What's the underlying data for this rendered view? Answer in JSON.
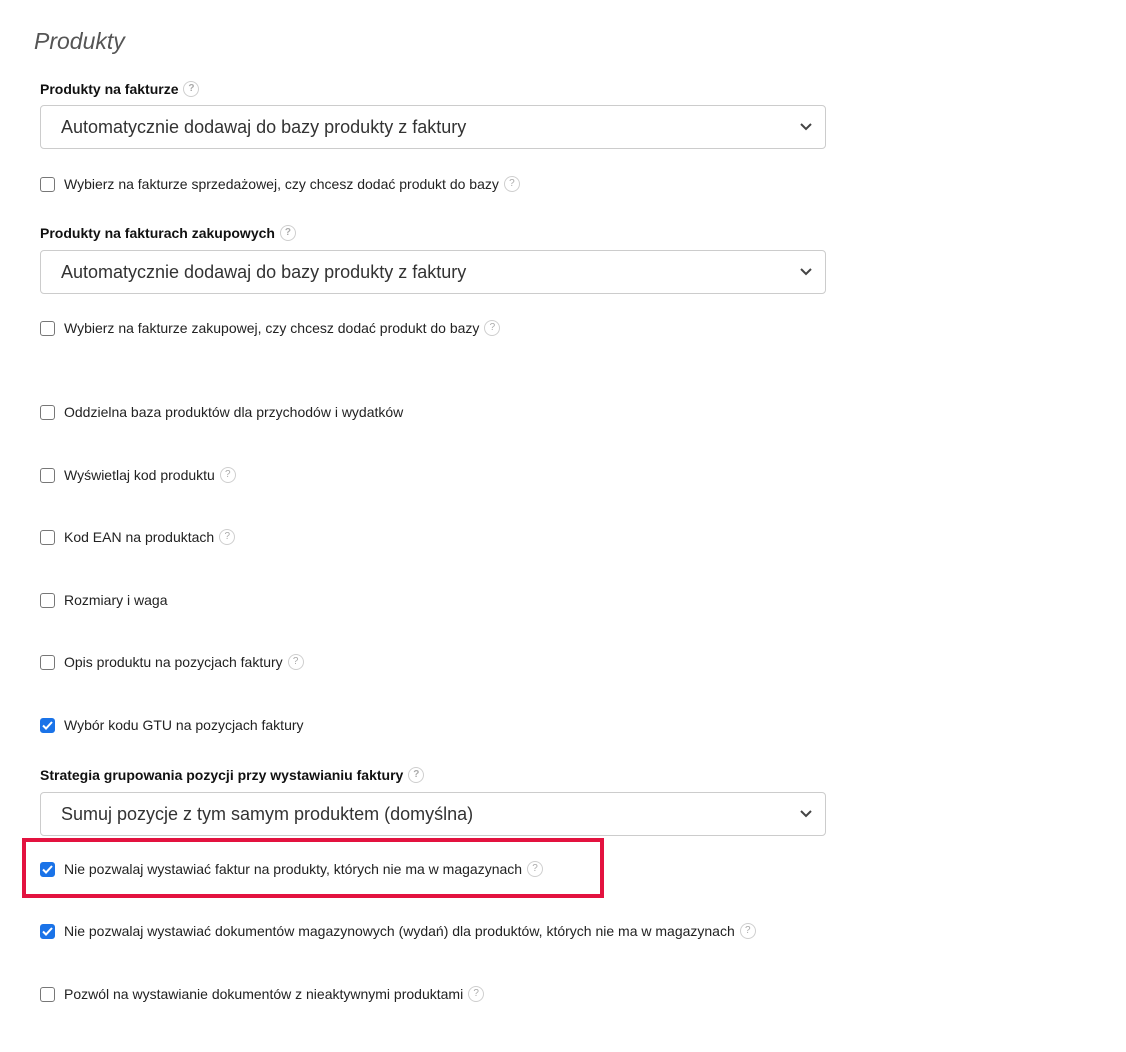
{
  "section": {
    "title": "Produkty"
  },
  "help_glyph": "?",
  "fields": {
    "sales": {
      "label": "Produkty na fakturze",
      "select_value": "Automatycznie dodawaj do bazy produkty z faktury"
    },
    "sales_choice": {
      "label": "Wybierz na fakturze sprzedażowej, czy chcesz dodać produkt do bazy",
      "checked": false
    },
    "purchase": {
      "label": "Produkty na fakturach zakupowych",
      "select_value": "Automatycznie dodawaj do bazy produkty z faktury"
    },
    "purchase_choice": {
      "label": "Wybierz na fakturze zakupowej, czy chcesz dodać produkt do bazy",
      "checked": false
    },
    "separate_db": {
      "label": "Oddzielna baza produktów dla przychodów i wydatków",
      "checked": false
    },
    "show_code": {
      "label": "Wyświetlaj kod produktu",
      "checked": false
    },
    "ean": {
      "label": "Kod EAN na produktach",
      "checked": false
    },
    "sizes": {
      "label": "Rozmiary i waga",
      "checked": false
    },
    "description": {
      "label": "Opis produktu na pozycjach faktury",
      "checked": false
    },
    "gtu": {
      "label": "Wybór kodu GTU na pozycjach faktury",
      "checked": true
    },
    "grouping": {
      "label": "Strategia grupowania pozycji przy wystawianiu faktury",
      "select_value": "Sumuj pozycje z tym samym produktem (domyślna)"
    },
    "no_invoice_out_of_stock": {
      "label": "Nie pozwalaj wystawiać faktur na produkty, których nie ma w magazynach",
      "checked": true
    },
    "no_warehouse_docs_out_of_stock": {
      "label": "Nie pozwalaj wystawiać dokumentów magazynowych (wydań) dla produktów, których nie ma w magazynach",
      "checked": true
    },
    "inactive_products": {
      "label": "Pozwól na wystawianie dokumentów z nieaktywnymi produktami",
      "checked": false
    }
  },
  "colors": {
    "highlight": "#e3123f",
    "checkbox_checked": "#1a73e8"
  }
}
